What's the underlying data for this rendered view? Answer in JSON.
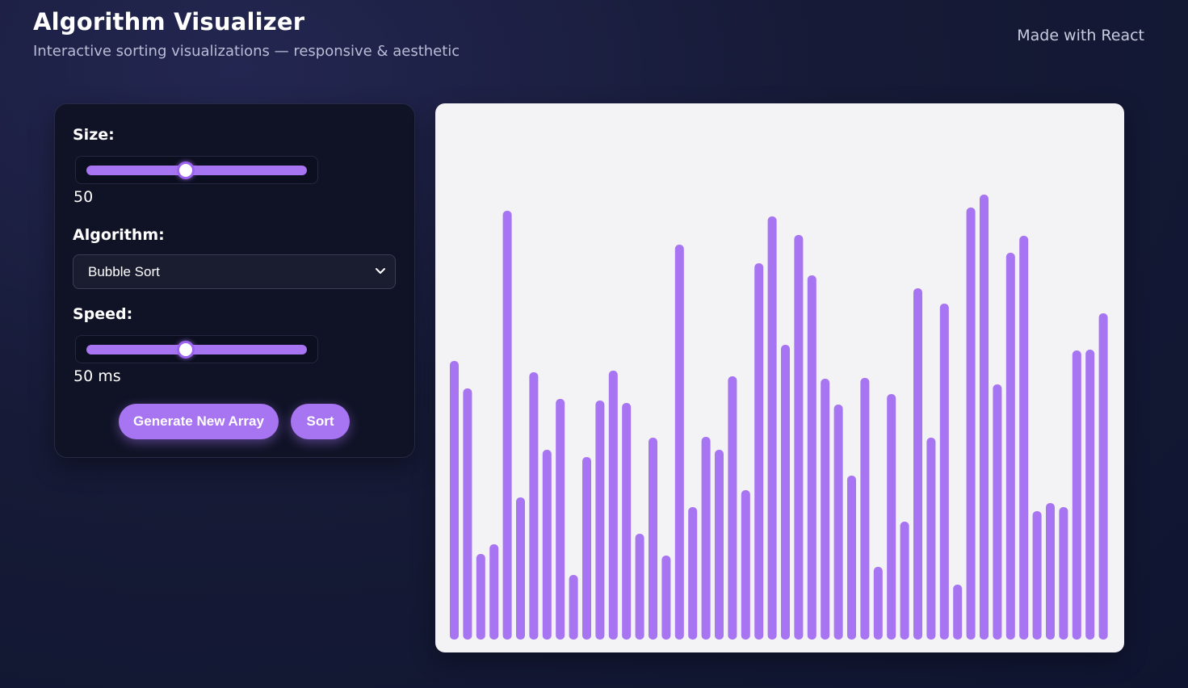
{
  "header": {
    "title": "Algorithm Visualizer",
    "subtitle": "Interactive sorting visualizations — responsive & aesthetic",
    "credit": "Made with React"
  },
  "controls": {
    "size_label": "Size:",
    "size_value": "50",
    "size_level": 0.45,
    "algorithm_label": "Algorithm:",
    "algorithm_selected": "Bubble Sort",
    "speed_label": "Speed:",
    "speed_value": "50 ms",
    "speed_level": 0.45,
    "generate_button": "Generate New Array",
    "sort_button": "Sort"
  },
  "colors": {
    "accent": "#a774f2",
    "panel_bg": "#101326",
    "chart_bg": "#f3f3f5"
  },
  "chart_data": {
    "type": "bar",
    "values": [
      345,
      311,
      106,
      118,
      531,
      176,
      331,
      235,
      298,
      80,
      226,
      296,
      333,
      293,
      131,
      250,
      104,
      489,
      164,
      251,
      235,
      326,
      185,
      466,
      524,
      365,
      501,
      451,
      323,
      291,
      203,
      324,
      90,
      304,
      146,
      435,
      250,
      416,
      68,
      535,
      551,
      316,
      479,
      500,
      159,
      169,
      164,
      358,
      359,
      404
    ],
    "ylim": [
      0,
      551
    ]
  }
}
